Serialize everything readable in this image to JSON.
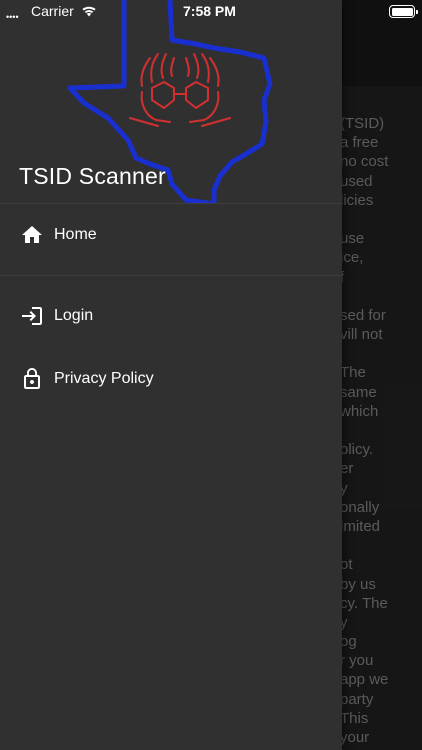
{
  "status_bar": {
    "signal": "••••",
    "carrier": "Carrier",
    "time": "7:58 PM"
  },
  "background_page": {
    "lines": [
      "(TSID)",
      "a  free",
      "no cost",
      "used",
      "licies",
      "",
      "use",
      "ice,",
      "f",
      "",
      "sed for",
      "vill not",
      "",
      "  The",
      "same",
      "which",
      "",
      "olicy.",
      "er",
      "y",
      "onally",
      "imited",
      "",
      "ot",
      "by us",
      "cy.  The",
      "y",
      "og",
      "r you",
      "app we",
      "  party",
      "This",
      "your"
    ]
  },
  "drawer": {
    "title": "TSID Scanner",
    "logo_icon": "texas-hands-logo",
    "items": [
      {
        "label": "Home",
        "icon": "home-icon"
      },
      {
        "label": "Login",
        "icon": "login-icon"
      },
      {
        "label": "Privacy Policy",
        "icon": "lock-icon"
      }
    ]
  },
  "colors": {
    "drawer_bg": "#303030",
    "logo_outline": "#1a2fd0",
    "logo_hands": "#d23030"
  }
}
